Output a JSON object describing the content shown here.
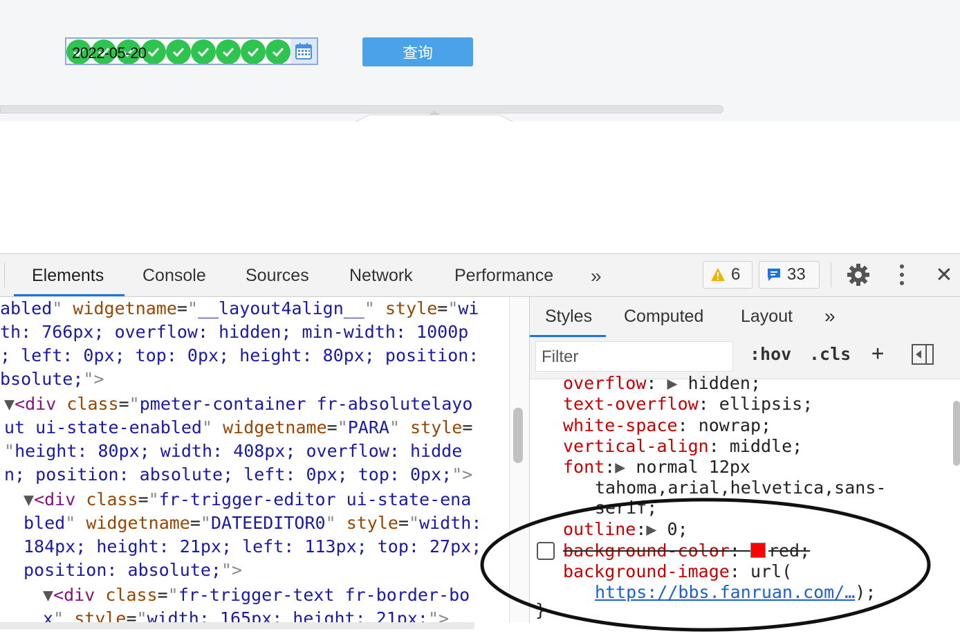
{
  "page": {
    "date_value": "2022-05-20",
    "query_label": "查询",
    "check_count": 9
  },
  "devtools": {
    "tabs": [
      "Elements",
      "Console",
      "Sources",
      "Network",
      "Performance"
    ],
    "more_glyph": "»",
    "warnings_count": "6",
    "messages_count": "33",
    "close_glyph": "✕",
    "elements_lines": [
      [
        {
          "c": "av",
          "t": "abled"
        },
        {
          "c": "q",
          "t": "\""
        },
        {
          "c": "",
          "t": " "
        },
        {
          "c": "an",
          "t": "widgetname"
        },
        {
          "c": "",
          "t": "="
        },
        {
          "c": "q",
          "t": "\""
        },
        {
          "c": "av",
          "t": "__layout4align__"
        },
        {
          "c": "q",
          "t": "\""
        },
        {
          "c": "",
          "t": " "
        },
        {
          "c": "an",
          "t": "style"
        },
        {
          "c": "",
          "t": "="
        },
        {
          "c": "q",
          "t": "\""
        },
        {
          "c": "av",
          "t": "wi"
        }
      ],
      [
        {
          "c": "av",
          "t": "th: 766px; overflow: hidden; min-width: 1000p"
        }
      ],
      [
        {
          "c": "av",
          "t": "; left: 0px; top: 0px; height: 80px; position:"
        }
      ],
      [
        {
          "c": "av",
          "t": "bsolute;"
        },
        {
          "c": "q",
          "t": "\">"
        }
      ],
      [
        {
          "c": "tri",
          "t": "▼"
        },
        {
          "c": "tn",
          "t": "<div"
        },
        {
          "c": "",
          "t": " "
        },
        {
          "c": "an",
          "t": "class"
        },
        {
          "c": "",
          "t": "="
        },
        {
          "c": "q",
          "t": "\""
        },
        {
          "c": "av",
          "t": "pmeter-container fr-absolutelayo"
        }
      ],
      [
        {
          "c": "av",
          "t": "ut ui-state-enabled"
        },
        {
          "c": "q",
          "t": "\""
        },
        {
          "c": "",
          "t": " "
        },
        {
          "c": "an",
          "t": "widgetname"
        },
        {
          "c": "",
          "t": "="
        },
        {
          "c": "q",
          "t": "\""
        },
        {
          "c": "av",
          "t": "PARA"
        },
        {
          "c": "q",
          "t": "\""
        },
        {
          "c": "",
          "t": " "
        },
        {
          "c": "an",
          "t": "style"
        },
        {
          "c": "",
          "t": "="
        }
      ],
      [
        {
          "c": "q",
          "t": "\""
        },
        {
          "c": "av",
          "t": "height: 80px; width: 408px; overflow: hidde"
        }
      ],
      [
        {
          "c": "av",
          "t": "n; position: absolute; left: 0px; top: 0px;"
        },
        {
          "c": "q",
          "t": "\">"
        }
      ],
      [
        {
          "c": "tri",
          "t": "▼"
        },
        {
          "c": "tn",
          "t": "<div"
        },
        {
          "c": "",
          "t": " "
        },
        {
          "c": "an",
          "t": "class"
        },
        {
          "c": "",
          "t": "="
        },
        {
          "c": "q",
          "t": "\""
        },
        {
          "c": "av",
          "t": "fr-trigger-editor ui-state-ena"
        }
      ],
      [
        {
          "c": "av",
          "t": "bled"
        },
        {
          "c": "q",
          "t": "\""
        },
        {
          "c": "",
          "t": " "
        },
        {
          "c": "an",
          "t": "widgetname"
        },
        {
          "c": "",
          "t": "="
        },
        {
          "c": "q",
          "t": "\""
        },
        {
          "c": "av",
          "t": "DATEEDITOR0"
        },
        {
          "c": "q",
          "t": "\""
        },
        {
          "c": "",
          "t": " "
        },
        {
          "c": "an",
          "t": "style"
        },
        {
          "c": "",
          "t": "="
        },
        {
          "c": "q",
          "t": "\""
        },
        {
          "c": "av",
          "t": "width:"
        }
      ],
      [
        {
          "c": "av",
          "t": "184px; height: 21px; left: 113px; top: 27px;"
        }
      ],
      [
        {
          "c": "av",
          "t": "position: absolute;"
        },
        {
          "c": "q",
          "t": "\">"
        }
      ],
      [
        {
          "c": "tri",
          "t": "▼"
        },
        {
          "c": "tn",
          "t": "<div"
        },
        {
          "c": "",
          "t": " "
        },
        {
          "c": "an",
          "t": "class"
        },
        {
          "c": "",
          "t": "="
        },
        {
          "c": "q",
          "t": "\""
        },
        {
          "c": "av",
          "t": "fr-trigger-text fr-border-bo"
        }
      ],
      [
        {
          "c": "av",
          "t": "x"
        },
        {
          "c": "q",
          "t": "\""
        },
        {
          "c": "",
          "t": " "
        },
        {
          "c": "an",
          "t": "style"
        },
        {
          "c": "",
          "t": "="
        },
        {
          "c": "q",
          "t": "\""
        },
        {
          "c": "av",
          "t": "width: 165px; height: 21px;"
        },
        {
          "c": "q",
          "t": "\">"
        }
      ]
    ],
    "styles": {
      "tabs": [
        "Styles",
        "Computed",
        "Layout"
      ],
      "more_glyph": "»",
      "filter_placeholder": "Filter",
      "hov_label": ":hov",
      "cls_label": ".cls",
      "plus_label": "+",
      "props": {
        "overflow_name": "overflow",
        "overflow_value": "hidden;",
        "text_overflow_name": "text-overflow",
        "text_overflow_value": "ellipsis;",
        "white_space_name": "white-space",
        "white_space_value": "nowrap;",
        "vertical_align_name": "vertical-align",
        "vertical_align_value": "middle;",
        "font_name": "font",
        "font_value_1": "normal 12px",
        "font_value_2": "tahoma,arial,helvetica,sans-",
        "font_value_3": "serif;",
        "outline_name": "outline",
        "outline_value": "0;",
        "bg_color_name": "background-color",
        "bg_color_value": "red;",
        "bg_image_name": "background-image",
        "bg_image_value": "url(",
        "bg_image_url": "https://bbs.fanruan.com/…",
        "bg_image_end": ");",
        "closing_brace": "}"
      },
      "swatch_color": "#ff0000"
    }
  }
}
